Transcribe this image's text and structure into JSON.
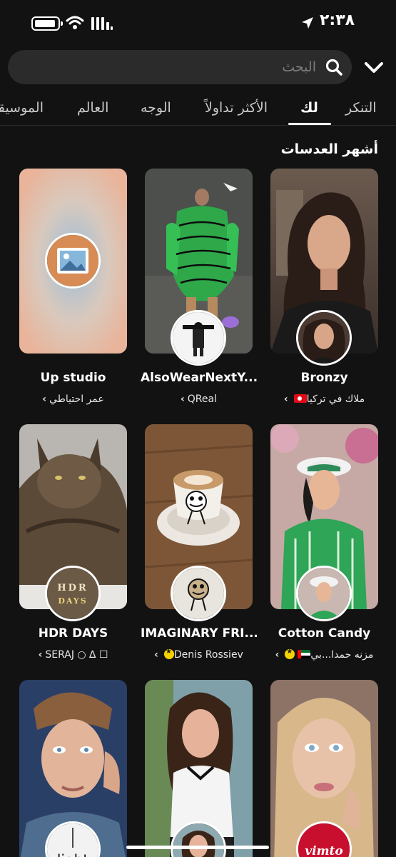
{
  "status_bar": {
    "time": "٢:٣٨"
  },
  "search": {
    "placeholder": "البحث"
  },
  "tabs": [
    {
      "label": "التنكر"
    },
    {
      "label": "لك"
    },
    {
      "label": "الأكثر تداولاً"
    },
    {
      "label": "الوجه"
    },
    {
      "label": "العالم"
    },
    {
      "label": "الموسيقى"
    }
  ],
  "section": {
    "title": "أشهر العدسات"
  },
  "lenses": [
    {
      "title": "Bronzy",
      "creator": "ملاك في تركيا",
      "badge": "flag-tr"
    },
    {
      "title": "AlsoWearNextY...",
      "creator": "QReal",
      "badge": ""
    },
    {
      "title": "Up studio",
      "creator": "عمر احتياطي",
      "badge": ""
    },
    {
      "title": "Cotton Candy",
      "creator": "مزنه حمدا...بي",
      "badge": "flag-ae-star"
    },
    {
      "title": "IMAGINARY FRI...",
      "creator": "Denis Rossiev",
      "badge": "star"
    },
    {
      "title": "HDR DAYS",
      "creator": "SERAJ ○ ∆ ☐",
      "badge": ""
    },
    {
      "title": "",
      "creator": "",
      "badge": ""
    },
    {
      "title": "",
      "creator": "",
      "badge": ""
    },
    {
      "title": "",
      "creator": "",
      "badge": ""
    }
  ],
  "avatars": {
    "hdr_text": "HDR DAYS",
    "light_text": "light",
    "vimto_text": "vimto"
  },
  "colors": {
    "background": "#121212",
    "search_bg": "#2b2b2b",
    "star": "#f5d300"
  }
}
